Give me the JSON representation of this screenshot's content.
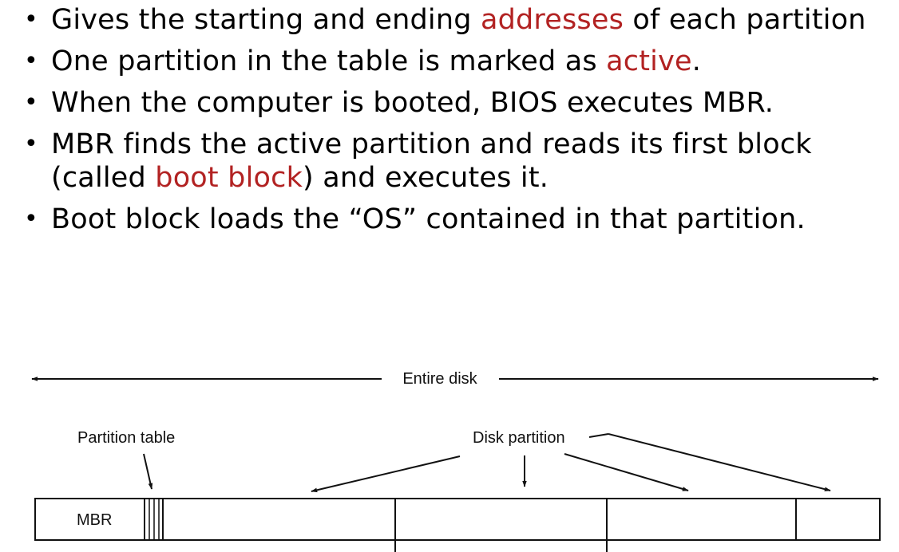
{
  "bullets": [
    {
      "parts": [
        {
          "text": "Gives the starting and ending "
        },
        {
          "text": "addresses",
          "highlight": true
        },
        {
          "text": " of each partition"
        }
      ]
    },
    {
      "parts": [
        {
          "text": "One partition in the table is marked as "
        },
        {
          "text": "active",
          "highlight": true
        },
        {
          "text": "."
        }
      ]
    },
    {
      "parts": [
        {
          "text": "When the computer is booted, BIOS executes MBR."
        }
      ]
    },
    {
      "parts": [
        {
          "text": "MBR finds the active partition and reads its first block (called "
        },
        {
          "text": "boot block",
          "highlight": true
        },
        {
          "text": ") and executes it."
        }
      ]
    },
    {
      "parts": [
        {
          "text": "Boot block loads the “OS” contained in that partition."
        }
      ]
    }
  ],
  "diagram": {
    "entire_disk_label": "Entire disk",
    "partition_table_label": "Partition table",
    "disk_partition_label": "Disk partition",
    "mbr_label": "MBR"
  },
  "colors": {
    "highlight": "#b22222",
    "text": "#000000"
  }
}
